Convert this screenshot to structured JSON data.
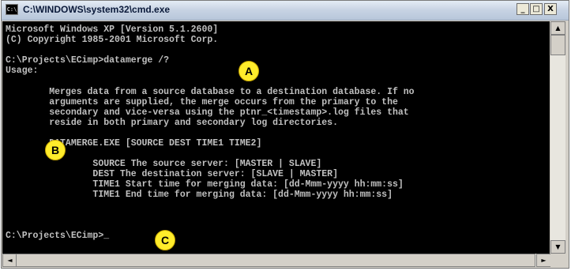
{
  "window": {
    "title": "C:\\WINDOWS\\system32\\cmd.exe",
    "icon_glyph": "C:\\",
    "controls": {
      "minimize": "_",
      "maximize": "□",
      "close": "X"
    }
  },
  "console": {
    "lines": [
      "Microsoft Windows XP [Version 5.1.2600]",
      "(C) Copyright 1985-2001 Microsoft Corp.",
      "",
      "C:\\Projects\\ECimp>datamerge /?",
      "Usage:",
      "",
      "        Merges data from a source database to a destination database. If no",
      "        arguments are supplied, the merge occurs from the primary to the",
      "        secondary and vice-versa using the ptnr_<timestamp>.log files that",
      "        reside in both primary and secondary log directories.",
      "",
      "        DATAMERGE.EXE [SOURCE DEST TIME1 TIME2]",
      "",
      "                SOURCE The source server: [MASTER | SLAVE]",
      "                DEST The destination server: [SLAVE | MASTER]",
      "                TIME1 Start time for merging data: [dd-Mmm-yyyy hh:mm:ss]",
      "                TIME1 End time for merging data: [dd-Mmm-yyyy hh:mm:ss]",
      "",
      "",
      "C:\\Projects\\ECimp>_"
    ]
  },
  "markers": {
    "a": "A",
    "b": "B",
    "c": "C"
  },
  "scrollbars": {
    "up": "▲",
    "down": "▼",
    "left": "◄",
    "right": "►"
  },
  "colors": {
    "console_bg": "#000000",
    "console_text": "#c0c0c0",
    "marker": "#ffec2b"
  }
}
